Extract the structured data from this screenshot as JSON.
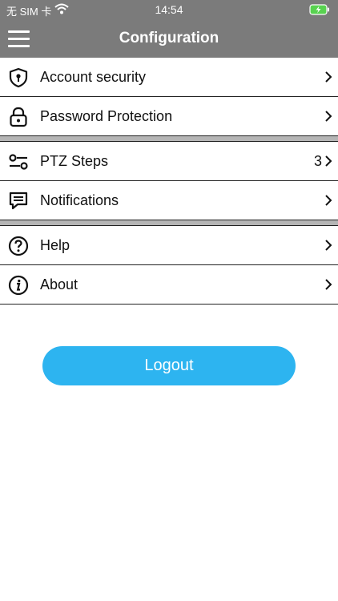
{
  "status_bar": {
    "carrier": "无 SIM 卡",
    "time": "14:54"
  },
  "header": {
    "title": "Configuration"
  },
  "list": {
    "account_security": "Account security",
    "password_protection": "Password Protection",
    "ptz_steps": "PTZ Steps",
    "ptz_steps_value": "3",
    "notifications": "Notifications",
    "help": "Help",
    "about": "About"
  },
  "logout_label": "Logout",
  "colors": {
    "header_bg": "#7b7b7b",
    "accent": "#2db4f0",
    "battery": "#58d250"
  },
  "icons": [
    "wifi-icon",
    "battery-icon",
    "hamburger-menu-icon",
    "shield-icon",
    "lock-icon",
    "sliders-icon",
    "chat-icon",
    "help-icon",
    "info-icon",
    "chevron-right-icon"
  ]
}
